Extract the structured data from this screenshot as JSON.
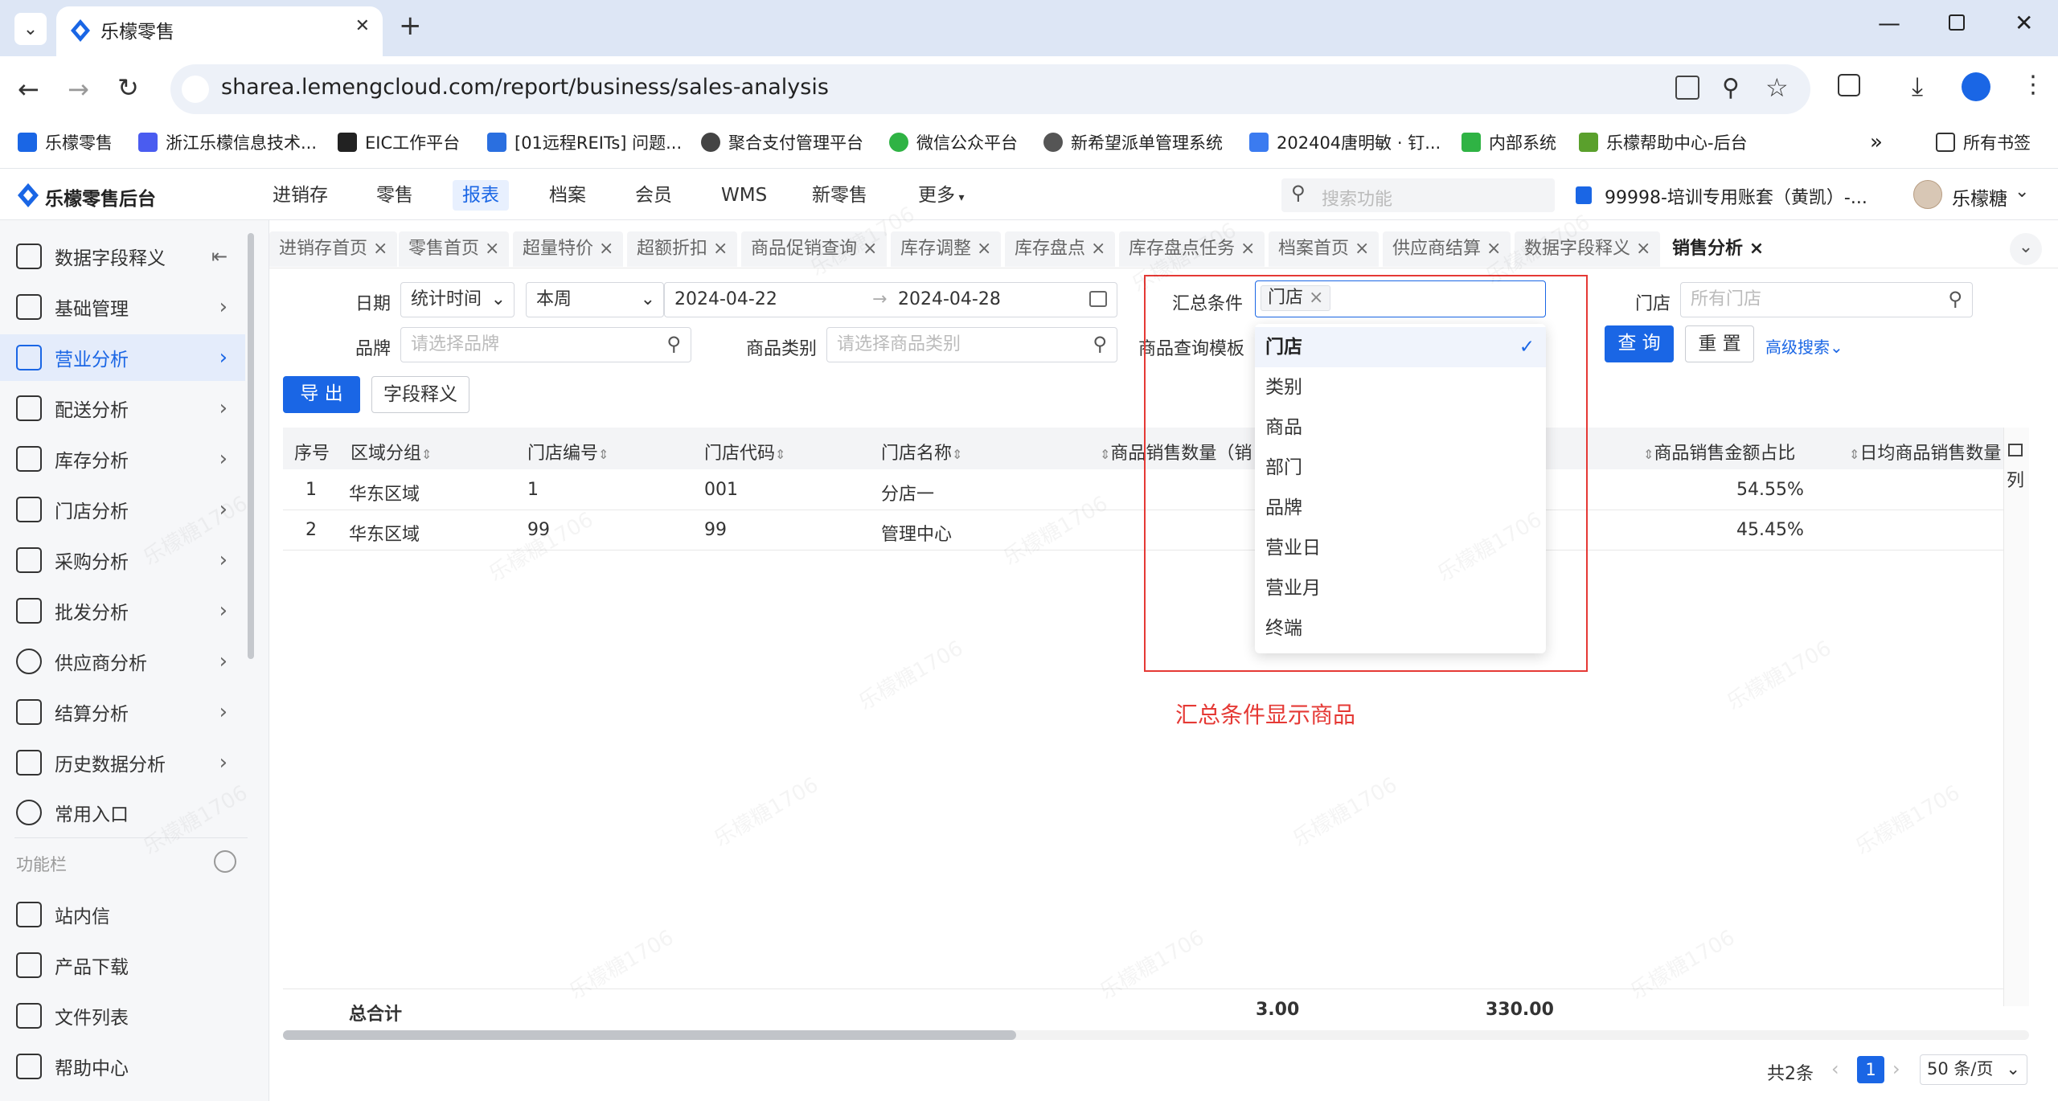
{
  "browser": {
    "tab_title": "乐檬零售",
    "tab_close": "✕",
    "new_tab": "+",
    "url": "sharea.lemengcloud.com/report/business/sales-analysis",
    "bookmarks": [
      {
        "label": "乐檬零售",
        "color": "#1a66e5"
      },
      {
        "label": "浙江乐檬信息技术...",
        "color": "#4a5cf0"
      },
      {
        "label": "EIC工作平台",
        "color": "#222"
      },
      {
        "label": "[01远程REITs] 问题...",
        "color": "#2a6fe0"
      },
      {
        "label": "聚合支付管理平台",
        "color": "#444"
      },
      {
        "label": "微信公众平台",
        "color": "#2fb344"
      },
      {
        "label": "新希望派单管理系统",
        "color": "#555"
      },
      {
        "label": "202404唐明敏 · 钉...",
        "color": "#3b7bf0"
      },
      {
        "label": "内部系统",
        "color": "#2fb344"
      },
      {
        "label": "乐檬帮助中心-后台",
        "color": "#5aa02c"
      }
    ],
    "all_bookmarks": "所有书签",
    "more_bookmarks": "»"
  },
  "app": {
    "logo_text": "乐檬零售后台",
    "nav": [
      "进销存",
      "零售",
      "报表",
      "档案",
      "会员",
      "WMS",
      "新零售",
      "更多"
    ],
    "active_nav": "报表",
    "search_placeholder": "搜索功能",
    "account": "99998-培训专用账套（黄凯）-...",
    "user": "乐檬糖"
  },
  "sidebar": {
    "items": [
      {
        "label": "数据字段释义"
      },
      {
        "label": "基础管理"
      },
      {
        "label": "营业分析"
      },
      {
        "label": "配送分析"
      },
      {
        "label": "库存分析"
      },
      {
        "label": "门店分析"
      },
      {
        "label": "采购分析"
      },
      {
        "label": "批发分析"
      },
      {
        "label": "供应商分析"
      },
      {
        "label": "结算分析"
      },
      {
        "label": "历史数据分析"
      },
      {
        "label": "常用入口"
      }
    ],
    "section_title": "功能栏",
    "bottom_items": [
      {
        "label": "站内信"
      },
      {
        "label": "产品下载"
      },
      {
        "label": "文件列表"
      },
      {
        "label": "帮助中心"
      }
    ]
  },
  "page_tabs": [
    "进销存首页",
    "零售首页",
    "超量特价",
    "超额折扣",
    "商品促销查询",
    "库存调整",
    "库存盘点",
    "库存盘点任务",
    "档案首页",
    "供应商结算",
    "数据字段释义",
    "销售分析"
  ],
  "active_tab": "销售分析",
  "filters": {
    "date_label": "日期",
    "date_type": "统计时间",
    "date_range": "本周",
    "date_start": "2024-04-22",
    "date_end": "2024-04-28",
    "summary_label": "汇总条件",
    "summary_tag": "门店",
    "store_label": "门店",
    "store_placeholder": "所有门店",
    "brand_label": "品牌",
    "brand_placeholder": "请选择品牌",
    "category_label": "商品类别",
    "category_placeholder": "请选择商品类别",
    "template_label": "商品查询模板",
    "query_button": "查 询",
    "reset_button": "重 置",
    "advanced": "高级搜索"
  },
  "actions": {
    "export": "导 出",
    "field_def": "字段释义"
  },
  "table": {
    "headers": [
      "序号",
      "区域分组",
      "门店编号",
      "门店代码",
      "门店名称",
      "商品销售数量（销",
      "商品销售金额占比",
      "日均商品销售数量"
    ],
    "rows": [
      {
        "idx": "1",
        "region": "华东区域",
        "store_no": "1",
        "store_code": "001",
        "store_name": "分店一",
        "ratio": "54.55%"
      },
      {
        "idx": "2",
        "region": "华东区域",
        "store_no": "99",
        "store_code": "99",
        "store_name": "管理中心",
        "ratio": "45.45%"
      }
    ],
    "column_setting": "列",
    "footer_label": "总合计",
    "footer_qty": "3.00",
    "footer_amount": "330.00"
  },
  "dropdown": {
    "options": [
      "门店",
      "类别",
      "商品",
      "部门",
      "品牌",
      "营业日",
      "营业月",
      "终端"
    ],
    "selected": "门店"
  },
  "annotation": "汇总条件显示商品",
  "pagination": {
    "total": "共2条",
    "current": "1",
    "page_size": "50 条/页"
  },
  "watermark": "乐檬糖1706",
  "colors": {
    "primary": "#1a66e5",
    "annotation": "#e53935"
  }
}
